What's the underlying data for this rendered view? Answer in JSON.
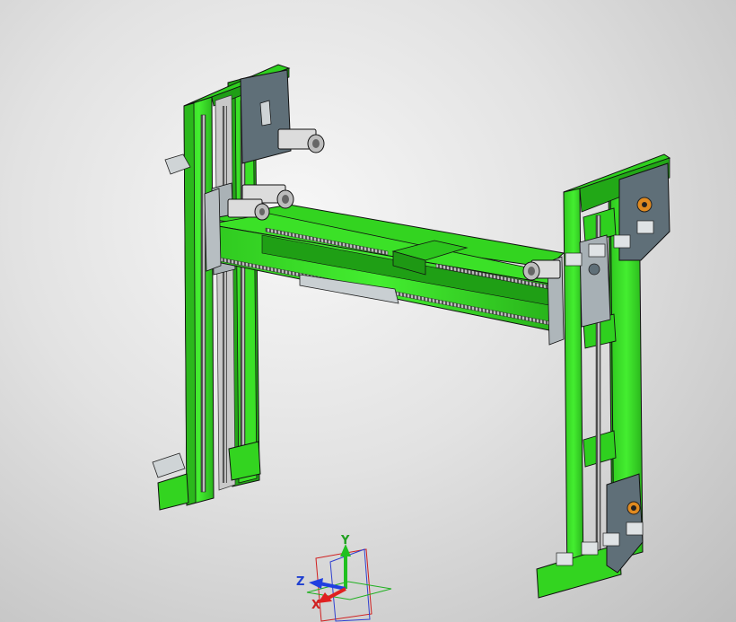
{
  "viewport": {
    "background_top": "#f8f8f8",
    "background_bottom": "#b9b9b9"
  },
  "model": {
    "frame_color": "#33dd22",
    "frame_dark": "#1f9f15",
    "plate_color": "#5f6f78",
    "motor_color": "#d8d8d8",
    "rack_color": "#555555"
  },
  "triad": {
    "x_label": "X",
    "y_label": "Y",
    "z_label": "Z",
    "x_color": "#e02020",
    "y_color": "#20c020",
    "z_color": "#2040e0"
  }
}
